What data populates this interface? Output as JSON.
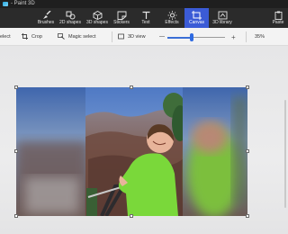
{
  "window": {
    "title": "- Paint 3D"
  },
  "ribbon": {
    "items": [
      {
        "label": "Brushes",
        "icon": "brush-icon"
      },
      {
        "label": "2D shapes",
        "icon": "2d-shapes-icon"
      },
      {
        "label": "3D shapes",
        "icon": "3d-shapes-icon"
      },
      {
        "label": "Stickers",
        "icon": "stickers-icon"
      },
      {
        "label": "Text",
        "icon": "text-icon"
      },
      {
        "label": "Effects",
        "icon": "effects-icon"
      },
      {
        "label": "Canvas",
        "icon": "canvas-icon",
        "active": true
      },
      {
        "label": "3D library",
        "icon": "3d-library-icon"
      },
      {
        "label": "Paste",
        "icon": "paste-icon"
      }
    ]
  },
  "toolbar": {
    "select_label": "elect",
    "crop_label": "Crop",
    "magic_select_label": "Magic select",
    "view3d_label": "3D view",
    "zoom_minus": "—",
    "zoom_plus": "+",
    "zoom_level": "35%",
    "zoom_fraction": 0.42
  },
  "colors": {
    "ribbon_bg": "#2b2b2b",
    "accent": "#3b5bd6",
    "toolbar_bg": "#f3f3f3",
    "workspace_bg": "#e9e9ea"
  }
}
